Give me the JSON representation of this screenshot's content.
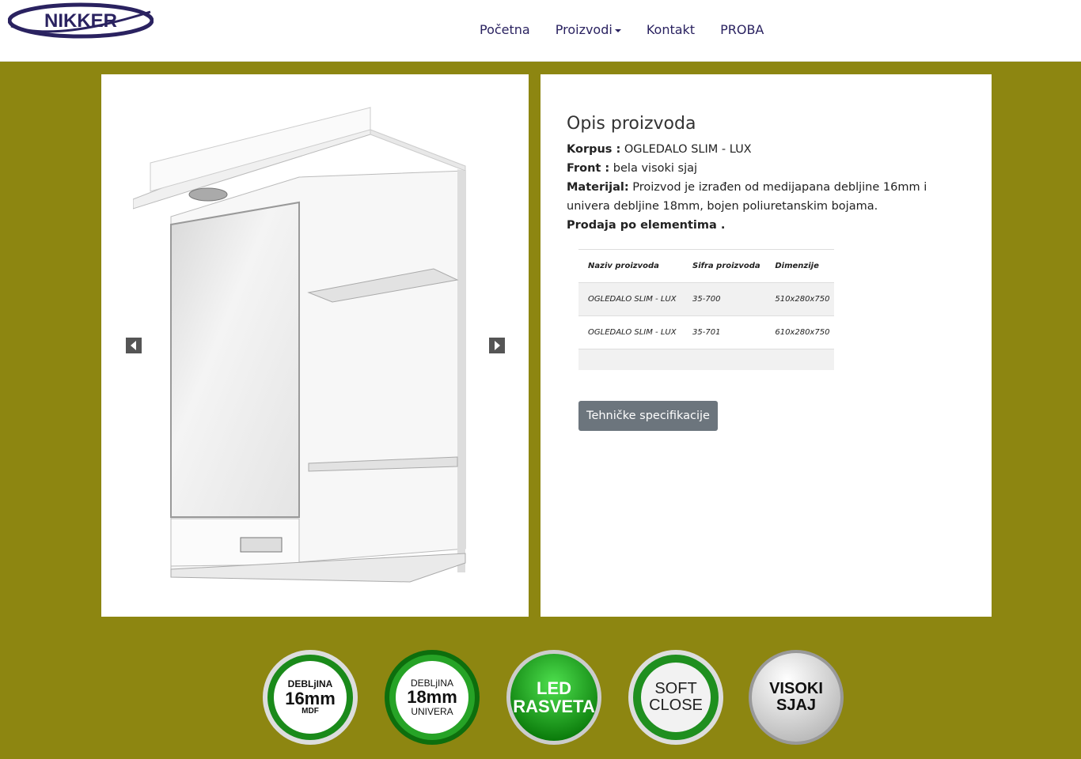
{
  "header": {
    "logo_text": "NIKKER",
    "nav": [
      {
        "label": "Početna"
      },
      {
        "label": "Proizvodi",
        "has_dropdown": true
      },
      {
        "label": "Kontakt"
      },
      {
        "label": "PROBA"
      }
    ]
  },
  "gallery": {
    "prev_icon": "chevron-left-icon",
    "next_icon": "chevron-right-icon"
  },
  "description": {
    "title": "Opis proizvoda",
    "korpus_label": "Korpus :",
    "korpus_value": " OGLEDALO SLIM - LUX",
    "front_label": "Front :",
    "front_value": " bela visoki sjaj",
    "materijal_label": "Materijal:",
    "materijal_value": " Proizvod je izrađen od medijapana debljine 16mm i univera debljine 18mm, bojen poliuretanskim bojama.",
    "prodaja": "Prodaja po elementima ."
  },
  "table": {
    "headers": [
      "Naziv proizvoda",
      "Sifra proizvoda",
      "Dimenzije"
    ],
    "rows": [
      [
        "OGLEDALO SLIM - LUX",
        "35-700",
        "510x280x750"
      ],
      [
        "OGLEDALO SLIM - LUX",
        "35-701",
        "610x280x750"
      ]
    ]
  },
  "spec_button": "Tehničke specifikacije",
  "badges": [
    {
      "line1": "DEBLjINA",
      "line2": "16mm",
      "line3": "MDF"
    },
    {
      "line1": "DEBLjINA",
      "line2": "18mm",
      "line3": "UNIVERA"
    },
    {
      "line1": "LED",
      "line2": "RASVETA"
    },
    {
      "line1": "SOFT",
      "line2": "CLOSE"
    },
    {
      "line1": "VISOKI",
      "line2": "SJAJ"
    }
  ],
  "colors": {
    "background": "#8d8611",
    "nav_text": "#2a2260",
    "button": "#6c757d",
    "badge_green": "#1a8a1a"
  }
}
